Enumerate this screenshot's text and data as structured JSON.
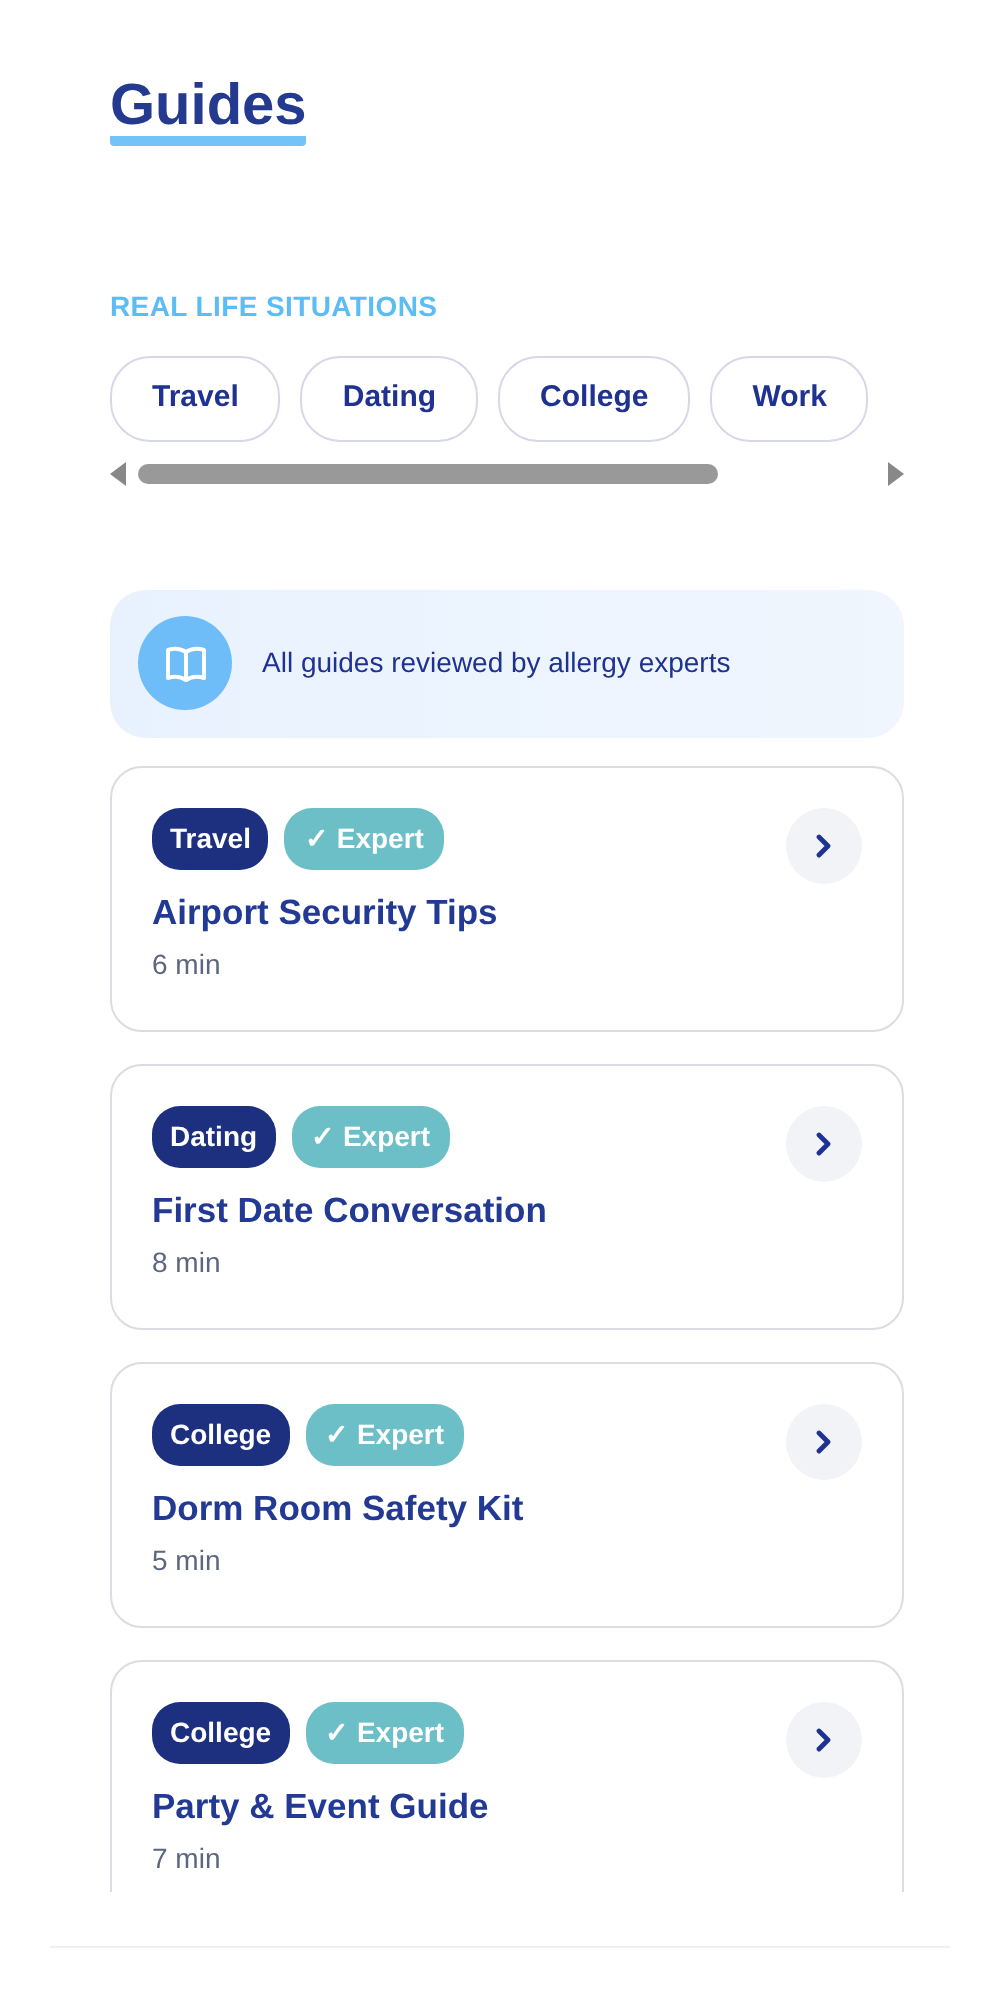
{
  "title": "Guides",
  "section_label": "REAL LIFE SITUATIONS",
  "chips": [
    {
      "label": "Travel"
    },
    {
      "label": "Dating"
    },
    {
      "label": "College"
    },
    {
      "label": "Work"
    }
  ],
  "banner": {
    "text": "All guides reviewed by allergy experts"
  },
  "guides": [
    {
      "category": "Travel",
      "badge": "✓ Expert",
      "title": "Airport Security Tips",
      "duration": "6 min"
    },
    {
      "category": "Dating",
      "badge": "✓ Expert",
      "title": "First Date Conversation",
      "duration": "8 min"
    },
    {
      "category": "College",
      "badge": "✓ Expert",
      "title": "Dorm Room Safety Kit",
      "duration": "5 min"
    },
    {
      "category": "College",
      "badge": "✓ Expert",
      "title": "Party & Event Guide",
      "duration": "7 min"
    }
  ]
}
